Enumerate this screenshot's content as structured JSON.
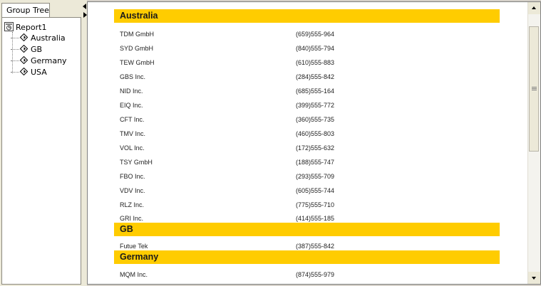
{
  "group_tree": {
    "tab_label": "Group Tree",
    "root": "Report1",
    "nodes": [
      "Australia",
      "GB",
      "Germany",
      "USA"
    ]
  },
  "report": {
    "groups": [
      {
        "name": "Australia",
        "rows": [
          {
            "company": "TDM GmbH",
            "phone": "(659)555-964"
          },
          {
            "company": "SYD GmbH",
            "phone": "(840)555-794"
          },
          {
            "company": "TEW GmbH",
            "phone": "(610)555-883"
          },
          {
            "company": "GBS Inc.",
            "phone": "(284)555-842"
          },
          {
            "company": "NID Inc.",
            "phone": "(685)555-164"
          },
          {
            "company": "EIQ Inc.",
            "phone": "(399)555-772"
          },
          {
            "company": "CFT Inc.",
            "phone": "(360)555-735"
          },
          {
            "company": "TMV Inc.",
            "phone": "(460)555-803"
          },
          {
            "company": "VOL Inc.",
            "phone": "(172)555-632"
          },
          {
            "company": "TSY GmbH",
            "phone": "(188)555-747"
          },
          {
            "company": "FBO Inc.",
            "phone": "(293)555-709"
          },
          {
            "company": "VDV Inc.",
            "phone": "(605)555-744"
          },
          {
            "company": "RLZ Inc.",
            "phone": "(775)555-710"
          },
          {
            "company": "GRI Inc.",
            "phone": "(414)555-185"
          }
        ]
      },
      {
        "name": "GB",
        "rows": [
          {
            "company": "Futue Tek",
            "phone": "(387)555-842"
          }
        ]
      },
      {
        "name": "Germany",
        "rows": [
          {
            "company": "MQM Inc.",
            "phone": "(874)555-979"
          }
        ]
      }
    ]
  },
  "colors": {
    "group_header": "#ffcc00",
    "panel_bg": "#ece9d8"
  }
}
